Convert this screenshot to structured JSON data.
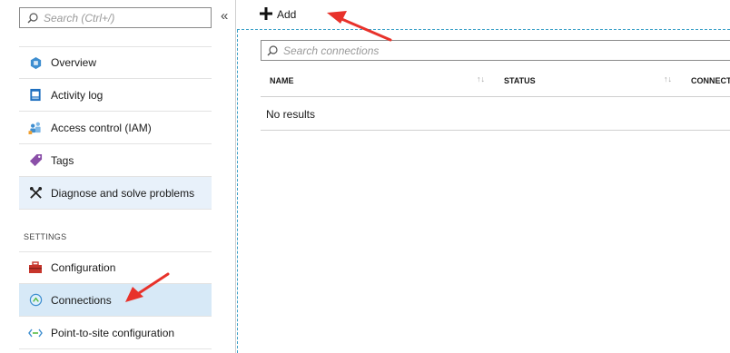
{
  "sidebar": {
    "search_placeholder": "Search (Ctrl+/)",
    "collapse_glyph": "«",
    "items": [
      {
        "label": "Overview",
        "icon": "overview-icon"
      },
      {
        "label": "Activity log",
        "icon": "activity-log-icon"
      },
      {
        "label": "Access control (IAM)",
        "icon": "iam-icon"
      },
      {
        "label": "Tags",
        "icon": "tag-icon"
      },
      {
        "label": "Diagnose and solve problems",
        "icon": "wrench-icon"
      }
    ],
    "section_label": "SETTINGS",
    "settings_items": [
      {
        "label": "Configuration",
        "icon": "toolbox-icon"
      },
      {
        "label": "Connections",
        "icon": "connections-icon"
      },
      {
        "label": "Point-to-site configuration",
        "icon": "point-to-site-icon"
      }
    ]
  },
  "toolbar": {
    "add_label": "Add"
  },
  "connections": {
    "search_placeholder": "Search connections",
    "columns": [
      "NAME",
      "STATUS",
      "CONNECT"
    ],
    "empty_text": "No results"
  },
  "colors": {
    "accent": "#0078d4",
    "annotation_arrow": "#e8322b",
    "active_item_bg": "#d7e9f7"
  }
}
